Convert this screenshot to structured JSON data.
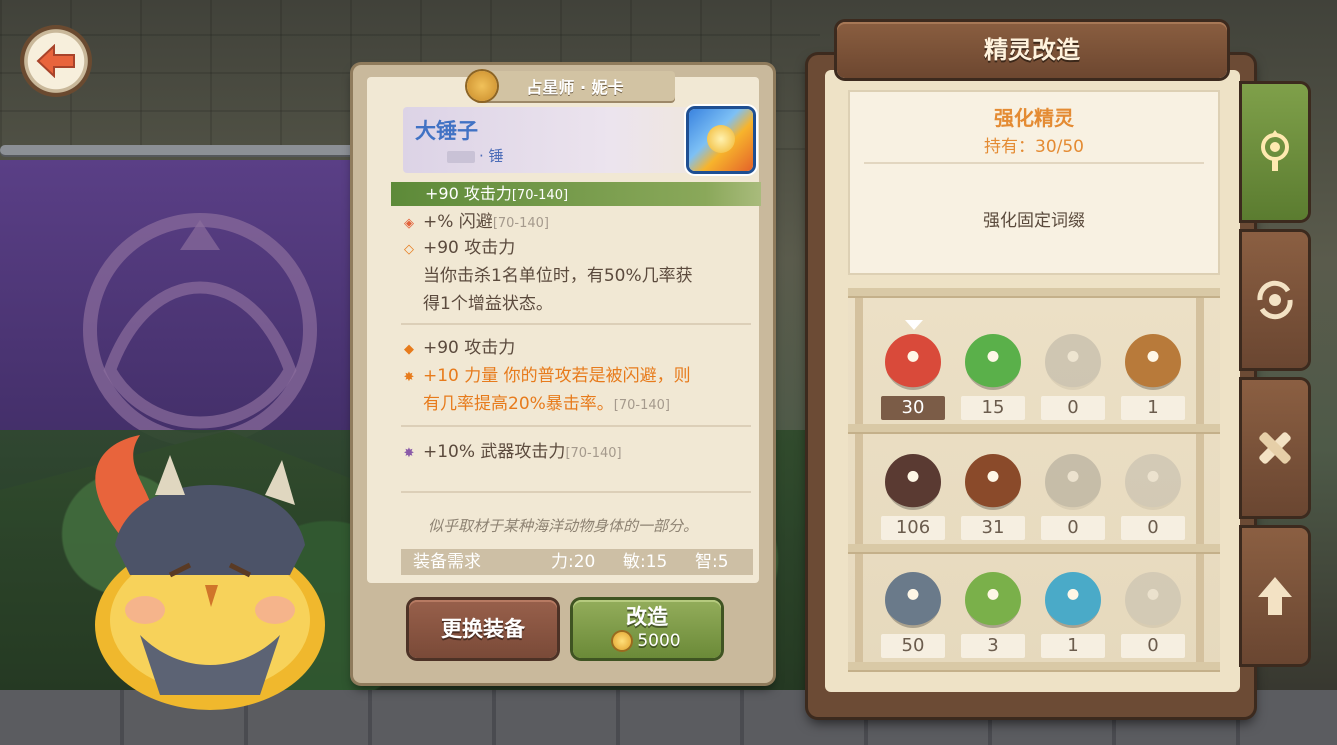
{
  "card": {
    "owner": "占星师 · 妮卡",
    "item_name": "大锤子",
    "item_type": "· 锤",
    "main_stat": {
      "text": "+90 攻击力",
      "range": "[70-140]"
    },
    "stats": [
      {
        "icon": "diamond-outline-icon",
        "text": "+% 闪避",
        "range": "[70-140]"
      },
      {
        "icon": "diamond-outline-icon",
        "text": "+90 攻击力",
        "range": ""
      },
      {
        "text": "当你击杀1名单位时，有50%几率获"
      },
      {
        "text": "得1个增益状态。"
      },
      {
        "icon": "diamond-icon",
        "text": "+90 攻击力",
        "range": ""
      },
      {
        "icon": "star-icon",
        "text": "+10 力量 你的普攻若是被闪避，则"
      },
      {
        "text": "有几率提高20%暴击率。",
        "range": "[70-140]"
      },
      {
        "icon": "star-icon",
        "text": "+10% 武器攻击力",
        "range": "[70-140]"
      }
    ],
    "description": "似乎取材于某种海洋动物身体的一部分。",
    "requirement": {
      "label": "装备需求",
      "str": "力:20",
      "agi": "敏:15",
      "int": "智:5"
    },
    "change_button": "更换装备",
    "reforge_button": "改造",
    "reforge_cost": "5000"
  },
  "panel": {
    "title": "精灵改造",
    "info_title": "强化精灵",
    "owned": "持有：30/50",
    "info_desc": "强化固定词缀"
  },
  "spirits": [
    {
      "count": "30",
      "selected": true,
      "color": "#d94a3a",
      "faded": false
    },
    {
      "count": "15",
      "selected": false,
      "color": "#5ab04a",
      "faded": false
    },
    {
      "count": "0",
      "selected": false,
      "color": "#9a7a5a",
      "faded": true
    },
    {
      "count": "1",
      "selected": false,
      "color": "#b87a3a",
      "faded": false
    },
    {
      "count": "106",
      "selected": false,
      "color": "#5a3a32",
      "faded": false
    },
    {
      "count": "31",
      "selected": false,
      "color": "#8a4a2a",
      "faded": false
    },
    {
      "count": "0",
      "selected": false,
      "color": "#8a5a3a",
      "faded": true
    },
    {
      "count": "0",
      "selected": false,
      "color": "#c08a70",
      "faded": true
    },
    {
      "count": "50",
      "selected": false,
      "color": "#6a7a8a",
      "faded": false
    },
    {
      "count": "3",
      "selected": false,
      "color": "#7ab04a",
      "faded": false
    },
    {
      "count": "1",
      "selected": false,
      "color": "#4aaac8",
      "faded": false
    },
    {
      "count": "0",
      "selected": false,
      "color": "#d88a8a",
      "faded": true
    }
  ],
  "side_tabs": [
    {
      "icon": "spirit-lamp-icon",
      "active": true
    },
    {
      "icon": "refresh-cycle-icon",
      "active": false
    },
    {
      "icon": "crossed-bandage-icon",
      "active": false
    },
    {
      "icon": "arrow-up-icon",
      "active": false
    }
  ],
  "colors": {
    "accent_orange": "#e48b33",
    "name_blue": "#4172c4",
    "stat_green": "#5d8a39"
  }
}
